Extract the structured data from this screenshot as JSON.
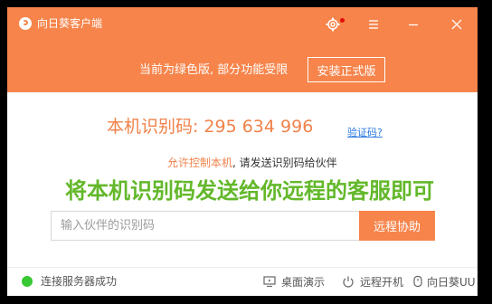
{
  "app": {
    "title": "向日葵客户端"
  },
  "banner": {
    "text": "当前为绿色版, 部分功能受限",
    "install_label": "安装正式版"
  },
  "local": {
    "id_label": "本机识别码:",
    "id_value": "295 634 996",
    "verify_label": "验证码?",
    "allow_label": "允许控制本机",
    "allow_suffix": ", 请发送识别码给伙伴"
  },
  "headline": "将本机识别码发送给你远程的客服即可",
  "partner": {
    "placeholder": "输入伙伴的识别码",
    "value": "",
    "remote_label": "远程协助"
  },
  "status": {
    "text": "连接服务器成功",
    "color": "#37c832",
    "desktop_demo": "桌面演示",
    "remote_boot": "远程开机",
    "uu": "向日葵UU"
  },
  "colors": {
    "accent": "#f6844b",
    "headline": "#63b82a",
    "link": "#2a7ae2"
  },
  "icons": [
    "app-logo-icon",
    "gear-icon",
    "menu-icon",
    "minimize-icon",
    "close-icon",
    "monitor-icon",
    "power-icon",
    "uu-icon"
  ]
}
